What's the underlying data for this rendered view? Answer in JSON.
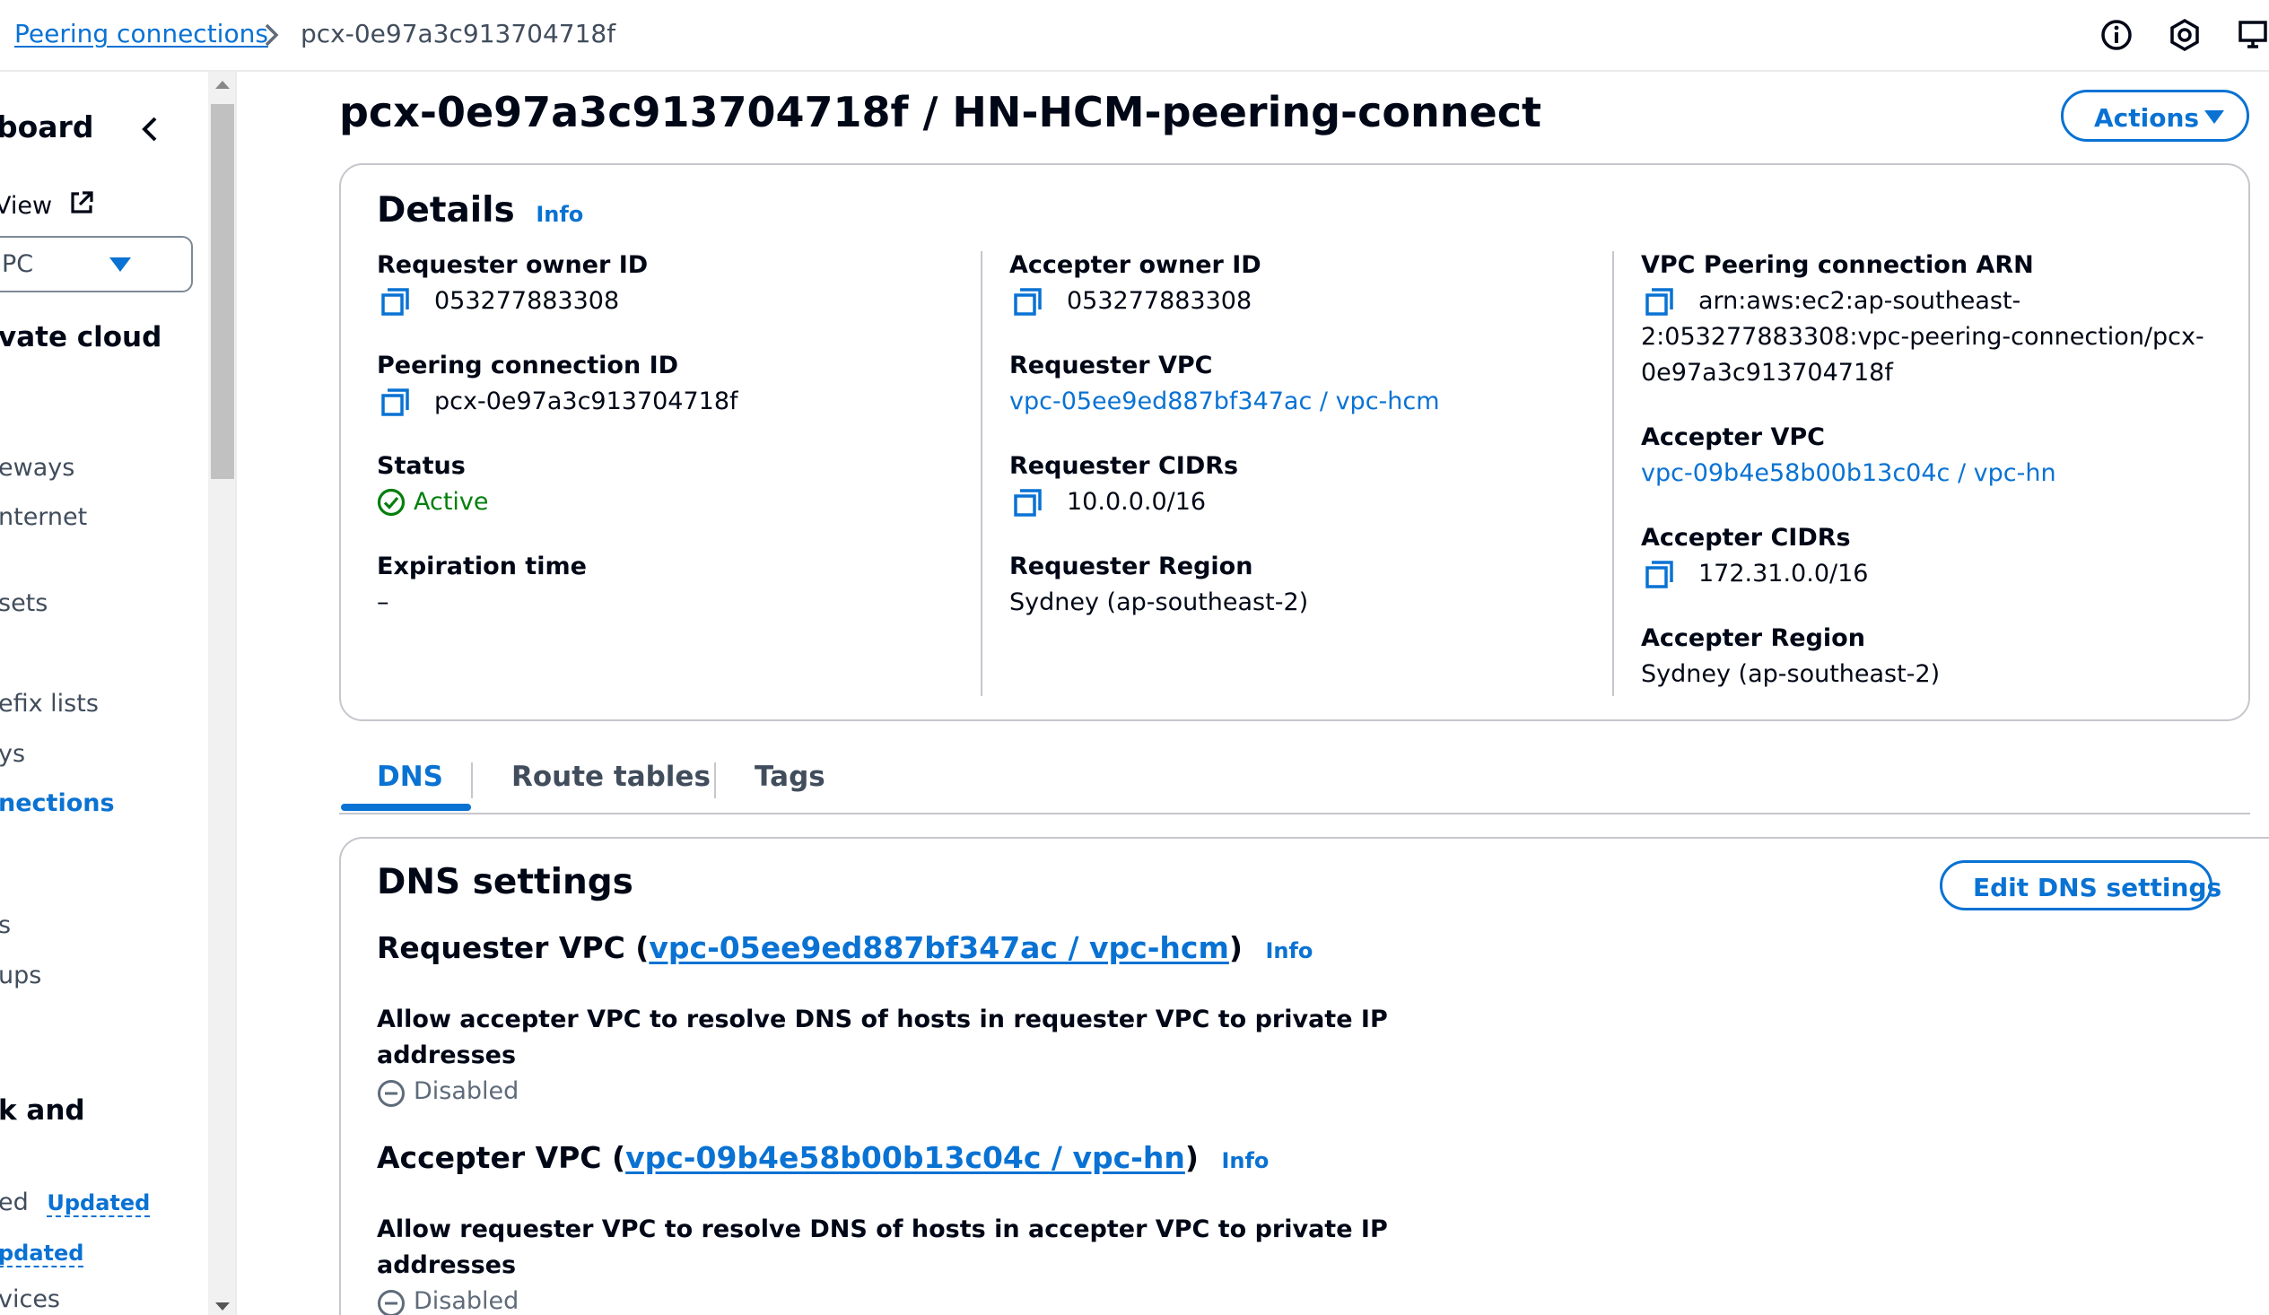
{
  "breadcrumb": {
    "parent": "Peering connections",
    "current": "pcx-0e97a3c913704718f"
  },
  "top_icons": [
    "info-circle-icon",
    "hexagon-icon",
    "screen-share-icon"
  ],
  "sidebar": {
    "dashboard": "board",
    "new_view": "View",
    "filter_value": "PC",
    "section_vpc": "vate cloud",
    "items": {
      "gateways": "eways",
      "internet": "nternet",
      "option_sets": "sets",
      "prefix_lists": "efix lists",
      "ys": "ys",
      "peering_connections": "nections",
      "ls": "s",
      "groups": "ups",
      "section_network": "k and",
      "ed": "ed",
      "updated_1": "Updated",
      "updated_2": "pdated",
      "services": "vices"
    }
  },
  "page": {
    "title": "pcx-0e97a3c913704718f / HN-HCM-peering-connect",
    "actions_label": "Actions"
  },
  "details": {
    "title": "Details",
    "info": "Info",
    "requester_owner_id_label": "Requester owner ID",
    "requester_owner_id": "053277883308",
    "peering_connection_id_label": "Peering connection ID",
    "peering_connection_id": "pcx-0e97a3c913704718f",
    "status_label": "Status",
    "status": "Active",
    "expiration_label": "Expiration time",
    "expiration": "–",
    "accepter_owner_id_label": "Accepter owner ID",
    "accepter_owner_id": "053277883308",
    "requester_vpc_label": "Requester VPC",
    "requester_vpc": "vpc-05ee9ed887bf347ac / vpc-hcm",
    "requester_cidrs_label": "Requester CIDRs",
    "requester_cidrs": "10.0.0.0/16",
    "requester_region_label": "Requester Region",
    "requester_region": "Sydney (ap-southeast-2)",
    "arn_label": "VPC Peering connection ARN",
    "arn_line1": "arn:aws:ec2:ap-southeast-",
    "arn_line2": "2:053277883308:vpc-peering-connection/pcx-",
    "arn_line3": "0e97a3c913704718f",
    "accepter_vpc_label": "Accepter VPC",
    "accepter_vpc": "vpc-09b4e58b00b13c04c / vpc-hn",
    "accepter_cidrs_label": "Accepter CIDRs",
    "accepter_cidrs": "172.31.0.0/16",
    "accepter_region_label": "Accepter Region",
    "accepter_region": "Sydney (ap-southeast-2)"
  },
  "tabs": [
    "DNS",
    "Route tables",
    "Tags"
  ],
  "dns": {
    "title": "DNS settings",
    "edit_label": "Edit DNS settings",
    "requester_prefix": "Requester VPC (",
    "requester_link": "vpc-05ee9ed887bf347ac / vpc-hcm",
    "requester_suffix": ")",
    "requester_info": "Info",
    "requester_allow_line1": "Allow accepter VPC to resolve DNS of hosts in requester VPC to private IP",
    "requester_allow_line2": "addresses",
    "requester_status": "Disabled",
    "accepter_prefix": "Accepter VPC (",
    "accepter_link": "vpc-09b4e58b00b13c04c / vpc-hn",
    "accepter_suffix": ")",
    "accepter_info": "Info",
    "accepter_allow_line1": "Allow requester VPC to resolve DNS of hosts in accepter VPC to private IP",
    "accepter_allow_line2": "addresses",
    "accepter_status": "Disabled"
  },
  "colors": {
    "link": "#0972d3",
    "success": "#037f0c",
    "text": "#000716",
    "muted": "#5f6b7a",
    "border": "#c6c6cd"
  }
}
